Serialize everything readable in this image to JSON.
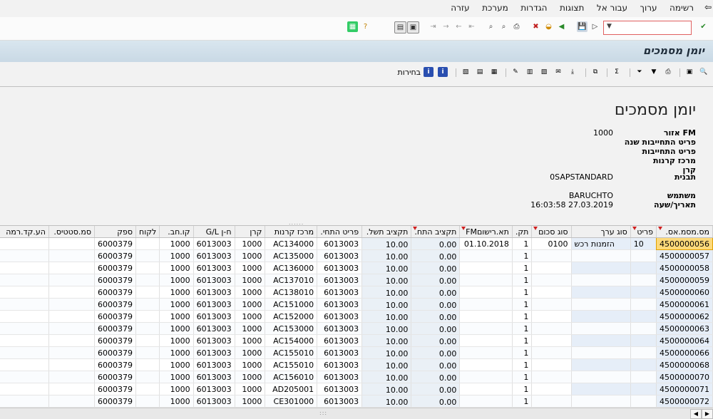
{
  "menu": {
    "items": [
      "רשימה",
      "ערוך",
      "עבור אל",
      "תצוגות",
      "הגדרות",
      "מערכת",
      "עזרה"
    ]
  },
  "toolbar": {
    "command_field_value": ""
  },
  "title": "יומן מסמכים",
  "app_toolbar": {
    "choices_label": "בחירות"
  },
  "report": {
    "title": "יומן מסמכים",
    "fields": [
      {
        "label": "אזור FM",
        "value": "1000"
      },
      {
        "label": "פריט התחייבות שנה",
        "value": ""
      },
      {
        "label": "פריט התחייבות",
        "value": ""
      },
      {
        "label": "מרכז קרנות",
        "value": ""
      },
      {
        "label": "קרן",
        "value": ""
      },
      {
        "label": "תבנית",
        "value": "0SAPSTANDARD"
      }
    ],
    "user_label": "משתמש",
    "user_value": "BARUCHTO",
    "datetime_label": "תאריך/שעה",
    "datetime_value": "16:03:58 27.03.2019"
  },
  "grid": {
    "columns": [
      {
        "label": "מס.מסמ.אס.",
        "sorted": true
      },
      {
        "label": "פריט",
        "sorted": true
      },
      {
        "label": "סוג ערך",
        "sorted": false
      },
      {
        "label": "סוג סכום",
        "sorted": true
      },
      {
        "label": "תק.",
        "sorted": false
      },
      {
        "label": "תא.רישוםFM",
        "sorted": true
      },
      {
        "label": "תקציב התח.",
        "sorted": true
      },
      {
        "label": "תקציב תשל.",
        "sorted": false
      },
      {
        "label": "פריט התחי.",
        "sorted": false
      },
      {
        "label": "מרכז קרנות",
        "sorted": false
      },
      {
        "label": "קרן",
        "sorted": false
      },
      {
        "label": "ח-ן G/L",
        "sorted": false
      },
      {
        "label": "קו.חב.",
        "sorted": false
      },
      {
        "label": "לקוח",
        "sorted": false
      },
      {
        "label": "ספק",
        "sorted": false
      },
      {
        "label": "סמ.סטטיס.",
        "sorted": false
      },
      {
        "label": "הע.קד.רמה",
        "sorted": false
      }
    ],
    "rows": [
      [
        "4500000056",
        "10",
        "הזמנות רכש",
        "0100",
        "1",
        "01.10.2018",
        "0.00",
        "10.00",
        "6013003",
        "AC134000",
        "1000",
        "6013003",
        "1000",
        "",
        "6000379",
        "",
        ""
      ],
      [
        "4500000057",
        "",
        "",
        "",
        "1",
        "",
        "0.00",
        "10.00",
        "6013003",
        "AC135000",
        "1000",
        "6013003",
        "1000",
        "",
        "6000379",
        "",
        ""
      ],
      [
        "4500000058",
        "",
        "",
        "",
        "1",
        "",
        "0.00",
        "10.00",
        "6013003",
        "AC136000",
        "1000",
        "6013003",
        "1000",
        "",
        "6000379",
        "",
        ""
      ],
      [
        "4500000059",
        "",
        "",
        "",
        "1",
        "",
        "0.00",
        "10.00",
        "6013003",
        "AC137010",
        "1000",
        "6013003",
        "1000",
        "",
        "6000379",
        "",
        ""
      ],
      [
        "4500000060",
        "",
        "",
        "",
        "1",
        "",
        "0.00",
        "10.00",
        "6013003",
        "AC138010",
        "1000",
        "6013003",
        "1000",
        "",
        "6000379",
        "",
        ""
      ],
      [
        "4500000061",
        "",
        "",
        "",
        "1",
        "",
        "0.00",
        "10.00",
        "6013003",
        "AC151000",
        "1000",
        "6013003",
        "1000",
        "",
        "6000379",
        "",
        ""
      ],
      [
        "4500000062",
        "",
        "",
        "",
        "1",
        "",
        "0.00",
        "10.00",
        "6013003",
        "AC152000",
        "1000",
        "6013003",
        "1000",
        "",
        "6000379",
        "",
        ""
      ],
      [
        "4500000063",
        "",
        "",
        "",
        "1",
        "",
        "0.00",
        "10.00",
        "6013003",
        "AC153000",
        "1000",
        "6013003",
        "1000",
        "",
        "6000379",
        "",
        ""
      ],
      [
        "4500000064",
        "",
        "",
        "",
        "1",
        "",
        "0.00",
        "10.00",
        "6013003",
        "AC154000",
        "1000",
        "6013003",
        "1000",
        "",
        "6000379",
        "",
        ""
      ],
      [
        "4500000066",
        "",
        "",
        "",
        "1",
        "",
        "0.00",
        "10.00",
        "6013003",
        "AC155010",
        "1000",
        "6013003",
        "1000",
        "",
        "6000379",
        "",
        ""
      ],
      [
        "4500000068",
        "",
        "",
        "",
        "1",
        "",
        "0.00",
        "10.00",
        "6013003",
        "AC155010",
        "1000",
        "6013003",
        "1000",
        "",
        "6000379",
        "",
        ""
      ],
      [
        "4500000070",
        "",
        "",
        "",
        "1",
        "",
        "0.00",
        "10.00",
        "6013003",
        "AC156010",
        "1000",
        "6013003",
        "1000",
        "",
        "6000379",
        "",
        ""
      ],
      [
        "4500000071",
        "",
        "",
        "",
        "1",
        "",
        "0.00",
        "10.00",
        "6013003",
        "AD205001",
        "1000",
        "6013003",
        "1000",
        "",
        "6000379",
        "",
        ""
      ],
      [
        "4500000072",
        "",
        "",
        "",
        "1",
        "",
        "0.00",
        "10.00",
        "6013003",
        "CE301000",
        "1000",
        "6013003",
        "1000",
        "",
        "6000379",
        "",
        ""
      ]
    ]
  },
  "colors": {
    "title_bar": "#d2e1ec",
    "selected_cell": "#fdd97a",
    "key_column": "#e6eef8",
    "sort_marker": "#d02020"
  }
}
